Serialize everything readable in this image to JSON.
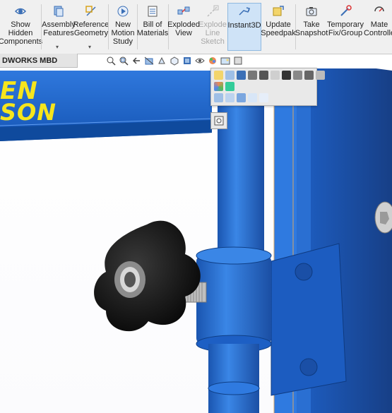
{
  "ribbon": {
    "buttons": [
      {
        "id": "show-hidden-components",
        "label": "Show\nHidden\nComponents",
        "state": "normal"
      },
      {
        "id": "assembly-features",
        "label": "Assembly\nFeatures",
        "state": "normal"
      },
      {
        "id": "reference-geometry",
        "label": "Reference\nGeometry",
        "state": "normal"
      },
      {
        "id": "new-motion-study",
        "label": "New\nMotion\nStudy",
        "state": "normal"
      },
      {
        "id": "bill-of-materials",
        "label": "Bill of\nMaterials",
        "state": "normal"
      },
      {
        "id": "exploded-view",
        "label": "Exploded\nView",
        "state": "normal"
      },
      {
        "id": "explode-line-sketch",
        "label": "Explode\nLine\nSketch",
        "state": "disabled"
      },
      {
        "id": "instant3d",
        "label": "Instant3D",
        "state": "active"
      },
      {
        "id": "update-speedpak",
        "label": "Update\nSpeedpak",
        "state": "normal"
      },
      {
        "id": "take-snapshot",
        "label": "Take\nSnapshot",
        "state": "normal"
      },
      {
        "id": "temporary-fix-group",
        "label": "Temporary\nFix/Group",
        "state": "normal"
      },
      {
        "id": "mate-controller",
        "label": "Mate\nControlle",
        "state": "normal"
      }
    ]
  },
  "tabs": {
    "active_label": "DWORKS MBD"
  },
  "graphics": {
    "brand_line1": "EN",
    "brand_line2": "SON"
  },
  "colors": {
    "frame_blue": "#1f63c6",
    "brand_yellow": "#f6e51c",
    "accent": "#0078d7"
  }
}
